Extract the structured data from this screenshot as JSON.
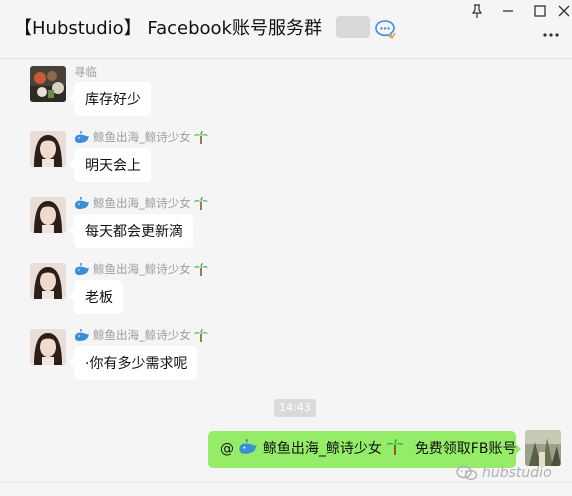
{
  "window": {
    "title": "【Hubstudio】 Facebook账号服务群",
    "buttons": [
      "pin",
      "minimize",
      "maximize",
      "close"
    ]
  },
  "messages": [
    {
      "sender": "寻临",
      "text": "库存好少",
      "avatar": "food-photo"
    },
    {
      "sender": "鲸鱼出海_鲸诗少女",
      "text": "明天会上",
      "avatar": "girl-photo"
    },
    {
      "sender": "鲸鱼出海_鲸诗少女",
      "text": "每天都会更新滴",
      "avatar": "girl-photo"
    },
    {
      "sender": "鲸鱼出海_鲸诗少女",
      "text": "老板",
      "avatar": "girl-photo"
    },
    {
      "sender": "鲸鱼出海_鲸诗少女",
      "text": "·你有多少需求呢",
      "avatar": "girl-photo"
    }
  ],
  "timestamp": "14:43",
  "my_message": {
    "at": "@",
    "mention": "鲸鱼出海_鲸诗少女",
    "text": "免费领取FB账号"
  },
  "watermark": "hubstudio",
  "icons": {
    "whale": "whale-icon",
    "palm": "palm-tree-icon",
    "chat": "chat-bubble-icon"
  },
  "colors": {
    "background": "#f5f5f5",
    "my_bubble": "#95ec69",
    "other_bubble": "#ffffff",
    "sender_name": "#9c9c9c"
  }
}
